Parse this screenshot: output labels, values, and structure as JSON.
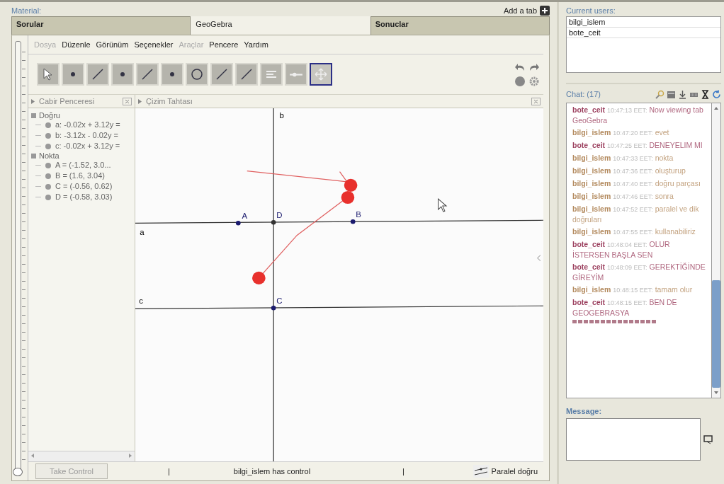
{
  "material": {
    "label": "Material:",
    "add_tab": "Add a tab"
  },
  "tabs": [
    {
      "label": "Sorular",
      "selected": false
    },
    {
      "label": "GeoGebra",
      "selected": true
    },
    {
      "label": "Sonuclar",
      "selected": false
    }
  ],
  "zoom_slider": {
    "level": 0
  },
  "menu": [
    {
      "label": "Dosya",
      "disabled": true
    },
    {
      "label": "Düzenle",
      "disabled": false
    },
    {
      "label": "Görünüm",
      "disabled": false
    },
    {
      "label": "Seçenekler",
      "disabled": false
    },
    {
      "label": "Araçlar",
      "disabled": true
    },
    {
      "label": "Pencere",
      "disabled": false
    },
    {
      "label": "Yardım",
      "disabled": false
    }
  ],
  "tools": [
    {
      "kind": "cursor",
      "selected": false
    },
    {
      "kind": "point",
      "selected": false
    },
    {
      "kind": "line",
      "selected": false
    },
    {
      "kind": "point",
      "selected": false
    },
    {
      "kind": "line",
      "selected": false
    },
    {
      "kind": "point",
      "selected": false
    },
    {
      "kind": "circle",
      "selected": false
    },
    {
      "kind": "line",
      "selected": false
    },
    {
      "kind": "line",
      "selected": false
    },
    {
      "kind": "text",
      "selected": false
    },
    {
      "kind": "slider",
      "selected": false
    },
    {
      "kind": "move",
      "selected": true
    }
  ],
  "algebra": {
    "title": "Cabir Penceresi",
    "groups": [
      {
        "label": "Doğru",
        "children": [
          {
            "label": "a: -0.02x + 3.12y ="
          },
          {
            "label": "b: -3.12x - 0.02y ="
          },
          {
            "label": "c: -0.02x + 3.12y ="
          }
        ]
      },
      {
        "label": "Nokta",
        "children": [
          {
            "label": "A = (-1.52, 3.0..."
          },
          {
            "label": "B = (1.6, 3.04)"
          },
          {
            "label": "C = (-0.56, 0.62)"
          },
          {
            "label": "D = (-0.58, 3.03)"
          }
        ]
      }
    ]
  },
  "graphics": {
    "title": "Çizim Tahtası",
    "lines": [
      {
        "label": "a",
        "kind": "horizontal"
      },
      {
        "label": "b",
        "kind": "vertical"
      },
      {
        "label": "c",
        "kind": "lower"
      }
    ],
    "points": [
      {
        "label": "A"
      },
      {
        "label": "D"
      },
      {
        "label": "B"
      },
      {
        "label": "C"
      }
    ]
  },
  "status": {
    "take_control": "Take Control",
    "take_control_disabled": true,
    "separator_left": "|",
    "control_text": "bilgi_islem has control",
    "separator_right": "|",
    "tool_name": "Paralel doğru"
  },
  "users": {
    "label": "Current users:",
    "items": [
      "bilgi_islem",
      "bote_ceit"
    ]
  },
  "chat": {
    "label": "Chat: (17)",
    "messages": [
      {
        "author": "bote_ceit",
        "time": "10:47:13 EET:",
        "text": "Now viewing tab GeoGebra",
        "color": "#9b3f5e"
      },
      {
        "author": "bilgi_islem",
        "time": "10:47:20 EET:",
        "text": "evet",
        "color": "#b38a5e"
      },
      {
        "author": "bote_ceit",
        "time": "10:47:25 EET:",
        "text": "DENEYELIM MI",
        "color": "#9b3f5e"
      },
      {
        "author": "bilgi_islem",
        "time": "10:47:33 EET:",
        "text": "nokta",
        "color": "#b38a5e"
      },
      {
        "author": "bilgi_islem",
        "time": "10:47:36 EET:",
        "text": "oluşturup",
        "color": "#b38a5e"
      },
      {
        "author": "bilgi_islem",
        "time": "10:47:40 EET:",
        "text": "doğru parçası",
        "color": "#b38a5e"
      },
      {
        "author": "bilgi_islem",
        "time": "10:47:46 EET:",
        "text": "sonra",
        "color": "#b38a5e"
      },
      {
        "author": "bilgi_islem",
        "time": "10:47:52 EET:",
        "text": "paralel ve dik doğruları",
        "color": "#b38a5e"
      },
      {
        "author": "bilgi_islem",
        "time": "10:47:55 EET:",
        "text": "kullanabiliriz",
        "color": "#b38a5e"
      },
      {
        "author": "bote_ceit",
        "time": "10:48:04 EET:",
        "text": "OLUR İSTERSEN BAŞLA SEN",
        "color": "#9b3f5e"
      },
      {
        "author": "bote_ceit",
        "time": "10:48:09 EET:",
        "text": "GEREKTİĞİNDE GİREYİM",
        "color": "#9b3f5e"
      },
      {
        "author": "bilgi_islem",
        "time": "10:48:15 EET:",
        "text": "tamam olur",
        "color": "#b38a5e"
      },
      {
        "author": "bote_ceit",
        "time": "10:48:15 EET:",
        "text": "BEN DE GEOGEBRASYA",
        "color": "#9b3f5e"
      }
    ]
  },
  "message": {
    "label": "Message:"
  }
}
